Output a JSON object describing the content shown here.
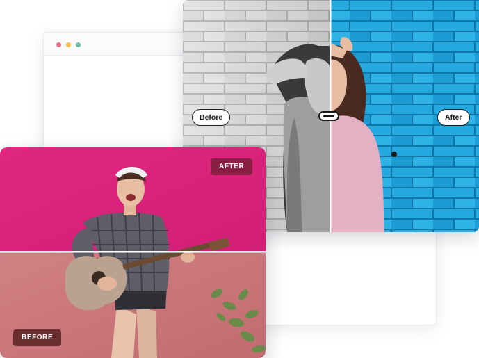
{
  "browser_window": {
    "dots": [
      {
        "name": "close-dot",
        "color": "#ea6c88"
      },
      {
        "name": "minimize-dot",
        "color": "#f0c44f"
      },
      {
        "name": "maximize-dot",
        "color": "#6cc2a0"
      }
    ]
  },
  "wall_comparison": {
    "before_label": "Before",
    "after_label": "After",
    "before_tone": "grayscale",
    "after_color": "#1fa4d6",
    "split_position": 0.5
  },
  "guitar_comparison": {
    "after_label": "AFTER",
    "before_label": "BEFORE",
    "after_color": "#e0227d",
    "before_color": "#c9757a",
    "after_tag_color": "#8a1f45",
    "before_tag_color": "#6a2d2d",
    "split_position": 0.5
  }
}
